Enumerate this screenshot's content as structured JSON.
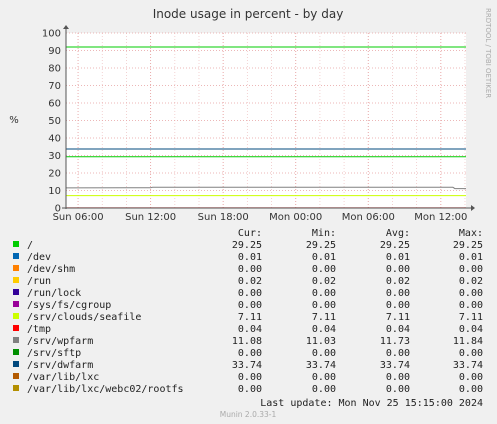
{
  "chart_data": {
    "type": "line",
    "title": "Inode usage in percent - by day",
    "ylabel": "%",
    "xlabel": "",
    "ylim": [
      0,
      100
    ],
    "y_ticks": [
      0,
      10,
      20,
      30,
      40,
      50,
      60,
      70,
      80,
      90,
      100
    ],
    "x_range": [
      "Sun 05:00",
      "Mon 14:05"
    ],
    "x_ticks": [
      "Sun 06:00",
      "Sun 12:00",
      "Sun 18:00",
      "Mon 00:00",
      "Mon 06:00",
      "Mon 12:00"
    ],
    "grid": true,
    "side_label": "RRDTOOL / TOBI OETIKER",
    "footer": "Munin 2.0.33-1",
    "last_update": "Last update:  Mon Nov 25 15:15:00 2024",
    "columns": [
      "Cur:",
      "Min:",
      "Avg:",
      "Max:"
    ],
    "series": [
      {
        "name": "/",
        "color": "#00cc00",
        "cur": "29.25",
        "min": "29.25",
        "avg": "29.25",
        "max": "29.25",
        "points": [
          [
            "Sun 05:00",
            29.25
          ],
          [
            "Mon 14:05",
            29.25
          ]
        ]
      },
      {
        "name": "/dev",
        "color": "#0066b3",
        "cur": "0.01",
        "min": "0.01",
        "avg": "0.01",
        "max": "0.01",
        "points": [
          [
            "Sun 05:00",
            0.01
          ],
          [
            "Mon 14:05",
            0.01
          ]
        ]
      },
      {
        "name": "/dev/shm",
        "color": "#ff8000",
        "cur": "0.00",
        "min": "0.00",
        "avg": "0.00",
        "max": "0.00",
        "points": [
          [
            "Sun 05:00",
            0.0
          ],
          [
            "Mon 14:05",
            0.0
          ]
        ]
      },
      {
        "name": "/run",
        "color": "#ffcc00",
        "cur": "0.02",
        "min": "0.02",
        "avg": "0.02",
        "max": "0.02",
        "points": [
          [
            "Sun 05:00",
            0.02
          ],
          [
            "Mon 14:05",
            0.02
          ]
        ]
      },
      {
        "name": "/run/lock",
        "color": "#330099",
        "cur": "0.00",
        "min": "0.00",
        "avg": "0.00",
        "max": "0.00",
        "points": [
          [
            "Sun 05:00",
            0.0
          ],
          [
            "Mon 14:05",
            0.0
          ]
        ]
      },
      {
        "name": "/sys/fs/cgroup",
        "color": "#990099",
        "cur": "0.00",
        "min": "0.00",
        "avg": "0.00",
        "max": "0.00",
        "points": [
          [
            "Sun 05:00",
            0.0
          ],
          [
            "Mon 14:05",
            0.0
          ]
        ]
      },
      {
        "name": "/srv/clouds/seafile",
        "color": "#ccff00",
        "cur": "7.11",
        "min": "7.11",
        "avg": "7.11",
        "max": "7.11",
        "points": [
          [
            "Sun 05:00",
            7.11
          ],
          [
            "Mon 14:05",
            7.11
          ]
        ]
      },
      {
        "name": "/tmp",
        "color": "#ff0000",
        "cur": "0.04",
        "min": "0.04",
        "avg": "0.04",
        "max": "0.04",
        "points": [
          [
            "Sun 05:00",
            0.04
          ],
          [
            "Mon 14:05",
            0.04
          ]
        ]
      },
      {
        "name": "/srv/wpfarm",
        "color": "#808080",
        "cur": "11.08",
        "min": "11.03",
        "avg": "11.73",
        "max": "11.84",
        "points": [
          [
            "Sun 05:00",
            11.5
          ],
          [
            "Sun 12:00",
            11.6
          ],
          [
            "Sun 12:10",
            11.84
          ],
          [
            "Mon 13:00",
            11.84
          ],
          [
            "Mon 13:10",
            11.08
          ],
          [
            "Mon 14:05",
            11.08
          ]
        ]
      },
      {
        "name": "/srv/sftp",
        "color": "#008f00",
        "cur": "0.00",
        "min": "0.00",
        "avg": "0.00",
        "max": "0.00",
        "points": [
          [
            "Sun 05:00",
            0.0
          ],
          [
            "Mon 14:05",
            0.0
          ]
        ]
      },
      {
        "name": "/srv/dwfarm",
        "color": "#00487d",
        "cur": "33.74",
        "min": "33.74",
        "avg": "33.74",
        "max": "33.74",
        "points": [
          [
            "Sun 05:00",
            33.74
          ],
          [
            "Mon 14:05",
            33.74
          ]
        ]
      },
      {
        "name": "/var/lib/lxc",
        "color": "#b35a00",
        "cur": "0.00",
        "min": "0.00",
        "avg": "0.00",
        "max": "0.00",
        "points": [
          [
            "Sun 05:00",
            0.0
          ],
          [
            "Mon 14:05",
            0.0
          ]
        ]
      },
      {
        "name": "/var/lib/lxc/webc02/rootfs",
        "color": "#b38f00",
        "cur": "0.00",
        "min": "0.00",
        "avg": "0.00",
        "max": "0.00",
        "points": [
          [
            "Sun 05:00",
            0.0
          ],
          [
            "Mon 14:05",
            0.0
          ]
        ]
      }
    ],
    "top_line": {
      "value": 92,
      "color": "#00cc00"
    }
  }
}
